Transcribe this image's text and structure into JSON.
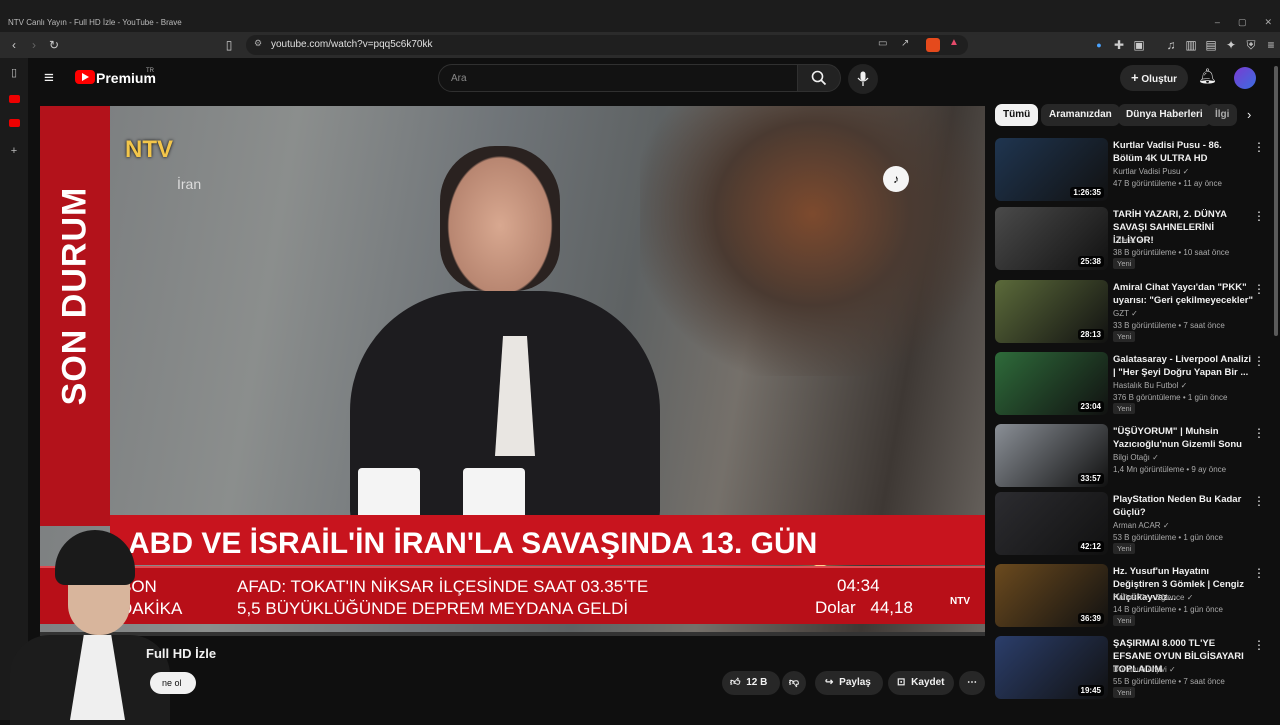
{
  "browser": {
    "window_title": "NTV Canlı Yayın - Full HD İzle - YouTube - Brave",
    "url": "youtube.com/watch?v=pqq5c6k70kk",
    "win_minimize": "–",
    "win_maximize": "▢",
    "win_close": "✕"
  },
  "header": {
    "logo_text": "Premium",
    "logo_region": "TR",
    "search_placeholder": "Ara",
    "create_label": "Oluştur"
  },
  "player": {
    "vertical_band": "SON DURUM",
    "channel_logo": "NTV",
    "location_label": "İran",
    "headline": "ABD VE İSRAİL'İN İRAN'LA SAVAŞINDA 13. GÜN",
    "ticker_tag_line1": "SON",
    "ticker_tag_line2": "DAKİKA",
    "ticker_line1": "AFAD: TOKAT'IN NİKSAR İLÇESİNDE SAAT 03.35'TE",
    "ticker_line2": "5,5 BÜYÜKLÜĞÜNDE DEPREM MEYDANA GELDİ",
    "ticker_time": "04:34",
    "ticker_currency_label": "Dolar",
    "ticker_currency_value": "44,18",
    "small_logo": "NTV",
    "progress": 0.0
  },
  "video": {
    "title": "Full HD İzle",
    "subscribe_label": "ne ol",
    "like_count": "12 B",
    "share_label": "Paylaş",
    "save_label": "Kaydet"
  },
  "chips": [
    "Tümü",
    "Aramanızdan",
    "Dünya Haberleri",
    "İlgi"
  ],
  "recommendations": [
    {
      "title": "Kurtlar Vadisi Pusu - 86. Bölüm 4K ULTRA HD",
      "channel": "Kurtlar Vadisi Pusu",
      "meta": "47 B görüntüleme • 11 ay önce",
      "duration": "1:26:35",
      "badge": "",
      "thumb_color": "#1f3550"
    },
    {
      "title": "TARİH YAZARI, 2. DÜNYA SAVAŞI SAHNELERİNİ İZLİYOR!",
      "channel": "Literat",
      "meta": "38 B görüntüleme • 10 saat önce",
      "duration": "25:38",
      "badge": "Yeni",
      "thumb_color": "#4a4a4a"
    },
    {
      "title": "Amiral Cihat Yaycı'dan \"PKK\" uyarısı: \"Geri çekilmeyecekler\"",
      "channel": "GZT",
      "meta": "33 B görüntüleme • 7 saat önce",
      "duration": "28:13",
      "badge": "Yeni",
      "thumb_color": "#5b6a3a"
    },
    {
      "title": "Galatasaray - Liverpool Analizi | \"Her Şeyi Doğru Yapan Bir ...",
      "channel": "Hastalık Bu Futbol",
      "meta": "376 B görüntüleme • 1 gün önce",
      "duration": "23:04",
      "badge": "Yeni",
      "thumb_color": "#2e6b3a"
    },
    {
      "title": "\"ÜŞÜYORUM\" | Muhsin Yazıcıoğlu'nun Gizemli Sonu",
      "channel": "Bilgi Otağı",
      "meta": "1,4 Mn görüntüleme • 9 ay önce",
      "duration": "33:57",
      "badge": "",
      "thumb_color": "#8a8f96"
    },
    {
      "title": "PlayStation Neden Bu Kadar Güçlü?",
      "channel": "Arman ACAR",
      "meta": "53 B görüntüleme • 1 gün önce",
      "duration": "42:12",
      "badge": "Yeni",
      "thumb_color": "#2c2c30"
    },
    {
      "title": "Hz. Yusuf'un Hayatını Değiştiren 3 Gömlek | Cengiz Küçükayvaz...",
      "channel": "Rafine TV - Eğlence",
      "meta": "14 B görüntüleme • 1 gün önce",
      "duration": "36:39",
      "badge": "Yeni",
      "thumb_color": "#6b4a1e"
    },
    {
      "title": "ŞAŞIRMAI 8.000 TL'YE EFSANE OYUN BİLGİSAYARI TOPLADIM",
      "channel": "Donanım Arşivi",
      "meta": "55 B görüntüleme • 7 saat önce",
      "duration": "19:45",
      "badge": "Yeni",
      "thumb_color": "#2b3e6b"
    }
  ],
  "colors": {
    "accent": "#ff0000",
    "ntv_red": "#c8141e",
    "background": "#0f0f0f"
  }
}
